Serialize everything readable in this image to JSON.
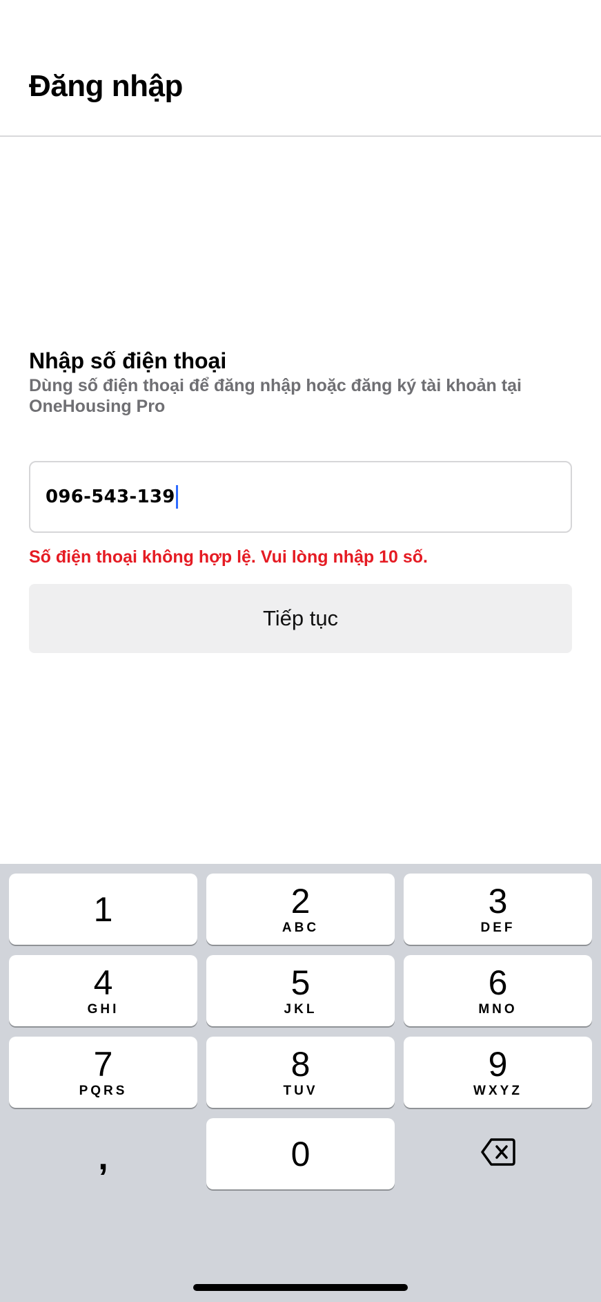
{
  "header": {
    "title": "Đăng nhập"
  },
  "form": {
    "title": "Nhập số điện thoại",
    "subtitle": "Dùng số điện thoại để đăng nhập hoặc đăng ký tài khoản tại OneHousing Pro",
    "phone_value": "096-543-139",
    "error": "Số điện thoại không hợp lệ. Vui lòng nhập 10 số.",
    "continue_label": "Tiếp tục"
  },
  "keyboard": {
    "keys": [
      {
        "digit": "1",
        "letters": ""
      },
      {
        "digit": "2",
        "letters": "ABC"
      },
      {
        "digit": "3",
        "letters": "DEF"
      },
      {
        "digit": "4",
        "letters": "GHI"
      },
      {
        "digit": "5",
        "letters": "JKL"
      },
      {
        "digit": "6",
        "letters": "MNO"
      },
      {
        "digit": "7",
        "letters": "PQRS"
      },
      {
        "digit": "8",
        "letters": "TUV"
      },
      {
        "digit": "9",
        "letters": "WXYZ"
      }
    ],
    "comma": ",",
    "zero": "0",
    "delete_icon": "backspace-icon"
  },
  "colors": {
    "error": "#e51b23",
    "caret": "#2f6bff",
    "keyboard_bg": "#d1d4da",
    "button_bg": "#efeff0"
  }
}
